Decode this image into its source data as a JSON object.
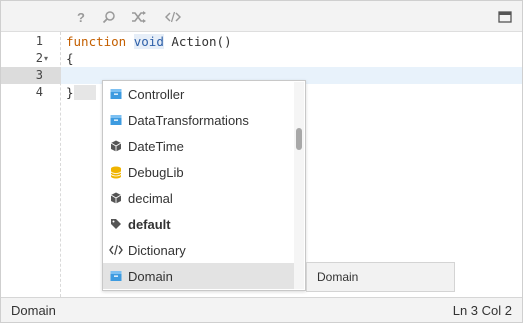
{
  "toolbar": {
    "help_icon": "question-mark-icon",
    "search_icon": "search-icon",
    "shuffle_icon": "shuffle-icon",
    "code_icon": "code-icon",
    "maximize_icon": "maximize-icon"
  },
  "gutter": {
    "lines": [
      "1",
      "2",
      "3",
      "4"
    ]
  },
  "code": {
    "line1_kw1": "function",
    "line1_kw2": "void",
    "line1_rest": " Action()",
    "line2": "{",
    "line4": "}"
  },
  "autocomplete": {
    "items": [
      {
        "label": "Controller",
        "icon": "module-icon"
      },
      {
        "label": "DataTransformations",
        "icon": "module-icon"
      },
      {
        "label": "DateTime",
        "icon": "cube-icon"
      },
      {
        "label": "DebugLib",
        "icon": "database-icon"
      },
      {
        "label": "decimal",
        "icon": "cube-icon"
      },
      {
        "label": "default",
        "icon": "tag-icon"
      },
      {
        "label": "Dictionary",
        "icon": "code-icon"
      },
      {
        "label": "Domain",
        "icon": "module-icon"
      }
    ],
    "selected_index": 7,
    "detail": "Domain"
  },
  "status": {
    "left": "Domain",
    "right": "Ln 3 Col 2"
  },
  "colors": {
    "keyword": "#c45f00",
    "type_keyword": "#2d5fa8",
    "module_icon": "#3d9be0",
    "database_icon": "#f0b400",
    "active_line": "#e8f2fb"
  }
}
